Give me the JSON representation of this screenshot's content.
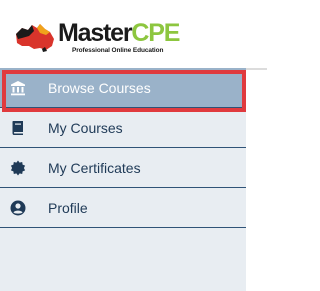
{
  "brand": {
    "name_main": "Master",
    "name_accent": "CPE",
    "tagline": "Professional Online Education",
    "accent_color": "#8dc63f"
  },
  "sidebar": {
    "background_color": "#e8edf2",
    "active_color": "#9ab2c9",
    "items": [
      {
        "label": "Browse Courses",
        "icon": "bank-icon",
        "active": true
      },
      {
        "label": "My Courses",
        "icon": "book-icon",
        "active": false
      },
      {
        "label": "My Certificates",
        "icon": "certificate-badge-icon",
        "active": false
      },
      {
        "label": "Profile",
        "icon": "user-circle-icon",
        "active": false
      }
    ]
  },
  "highlight": {
    "color": "#e03a3e",
    "target": "Browse Courses"
  }
}
